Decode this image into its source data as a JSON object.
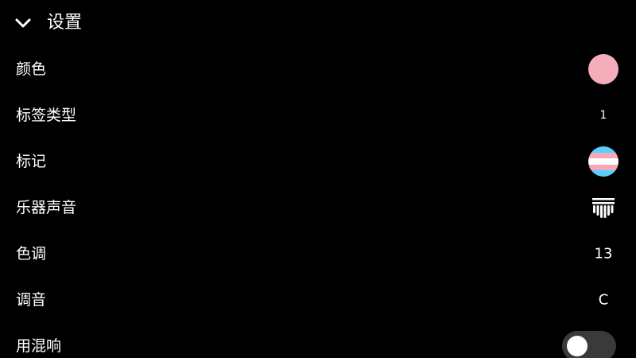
{
  "header": {
    "title": "设置",
    "back_icon": "chevron-down-icon"
  },
  "settings": [
    {
      "label": "颜色",
      "kind": "color",
      "value_color": "#f5adbb"
    },
    {
      "label": "标签类型",
      "kind": "text",
      "value": "1"
    },
    {
      "label": "标记",
      "kind": "flag",
      "stripe_colors": [
        "#5bcefa",
        "#f5a9b8",
        "#ffffff",
        "#f5a9b8",
        "#5bcefa"
      ]
    },
    {
      "label": "乐器声音",
      "kind": "icon",
      "icon": "kalimba-icon"
    },
    {
      "label": "色调",
      "kind": "text",
      "value": "13"
    },
    {
      "label": "调音",
      "kind": "text",
      "value": "C"
    },
    {
      "label": "用混响",
      "kind": "toggle",
      "toggle_on": false
    }
  ],
  "colors": {
    "background": "#000000",
    "text": "#ffffff",
    "toggle_track_off": "#3a3a3a",
    "toggle_knob": "#ffffff"
  }
}
